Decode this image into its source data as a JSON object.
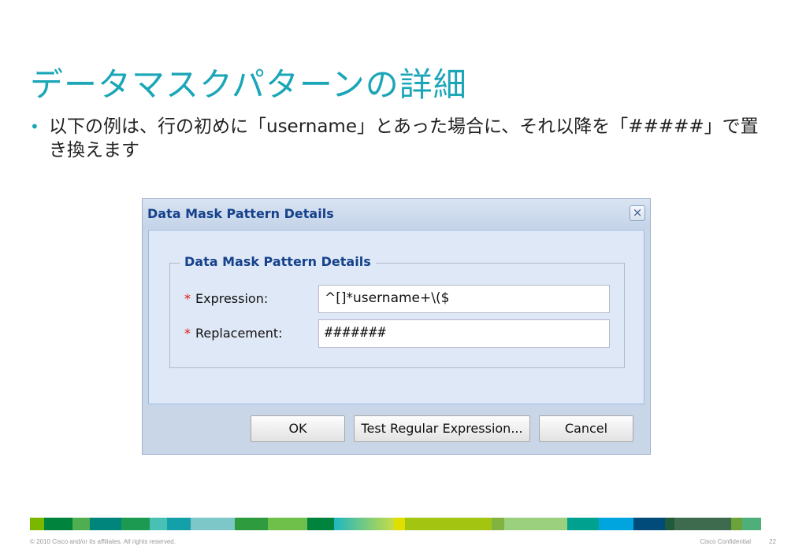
{
  "slide": {
    "title": "データマスクパターンの詳細",
    "bullet": "以下の例は、行の初めに「username」とあった場合に、それ以降を「#####」で置き換えます"
  },
  "dialog": {
    "title": "Data Mask Pattern Details",
    "close_icon": "×",
    "fieldset_legend": "Data Mask Pattern Details",
    "required_mark": "*",
    "fields": [
      {
        "label": "Expression:",
        "value": "^[]*username+\\($"
      },
      {
        "label": "Replacement:",
        "value": "#######"
      }
    ],
    "buttons": {
      "ok": "OK",
      "test": "Test Regular Expression...",
      "cancel": "Cancel"
    }
  },
  "footer": {
    "copyright": "© 2010 Cisco and/or its affiliates. All rights reserved.",
    "confidential": "Cisco Confidential",
    "page_number": "22"
  },
  "colors": {
    "title_teal": "#1ba6b8",
    "dialog_title_blue": "#15428b",
    "required_red": "#e31414"
  }
}
